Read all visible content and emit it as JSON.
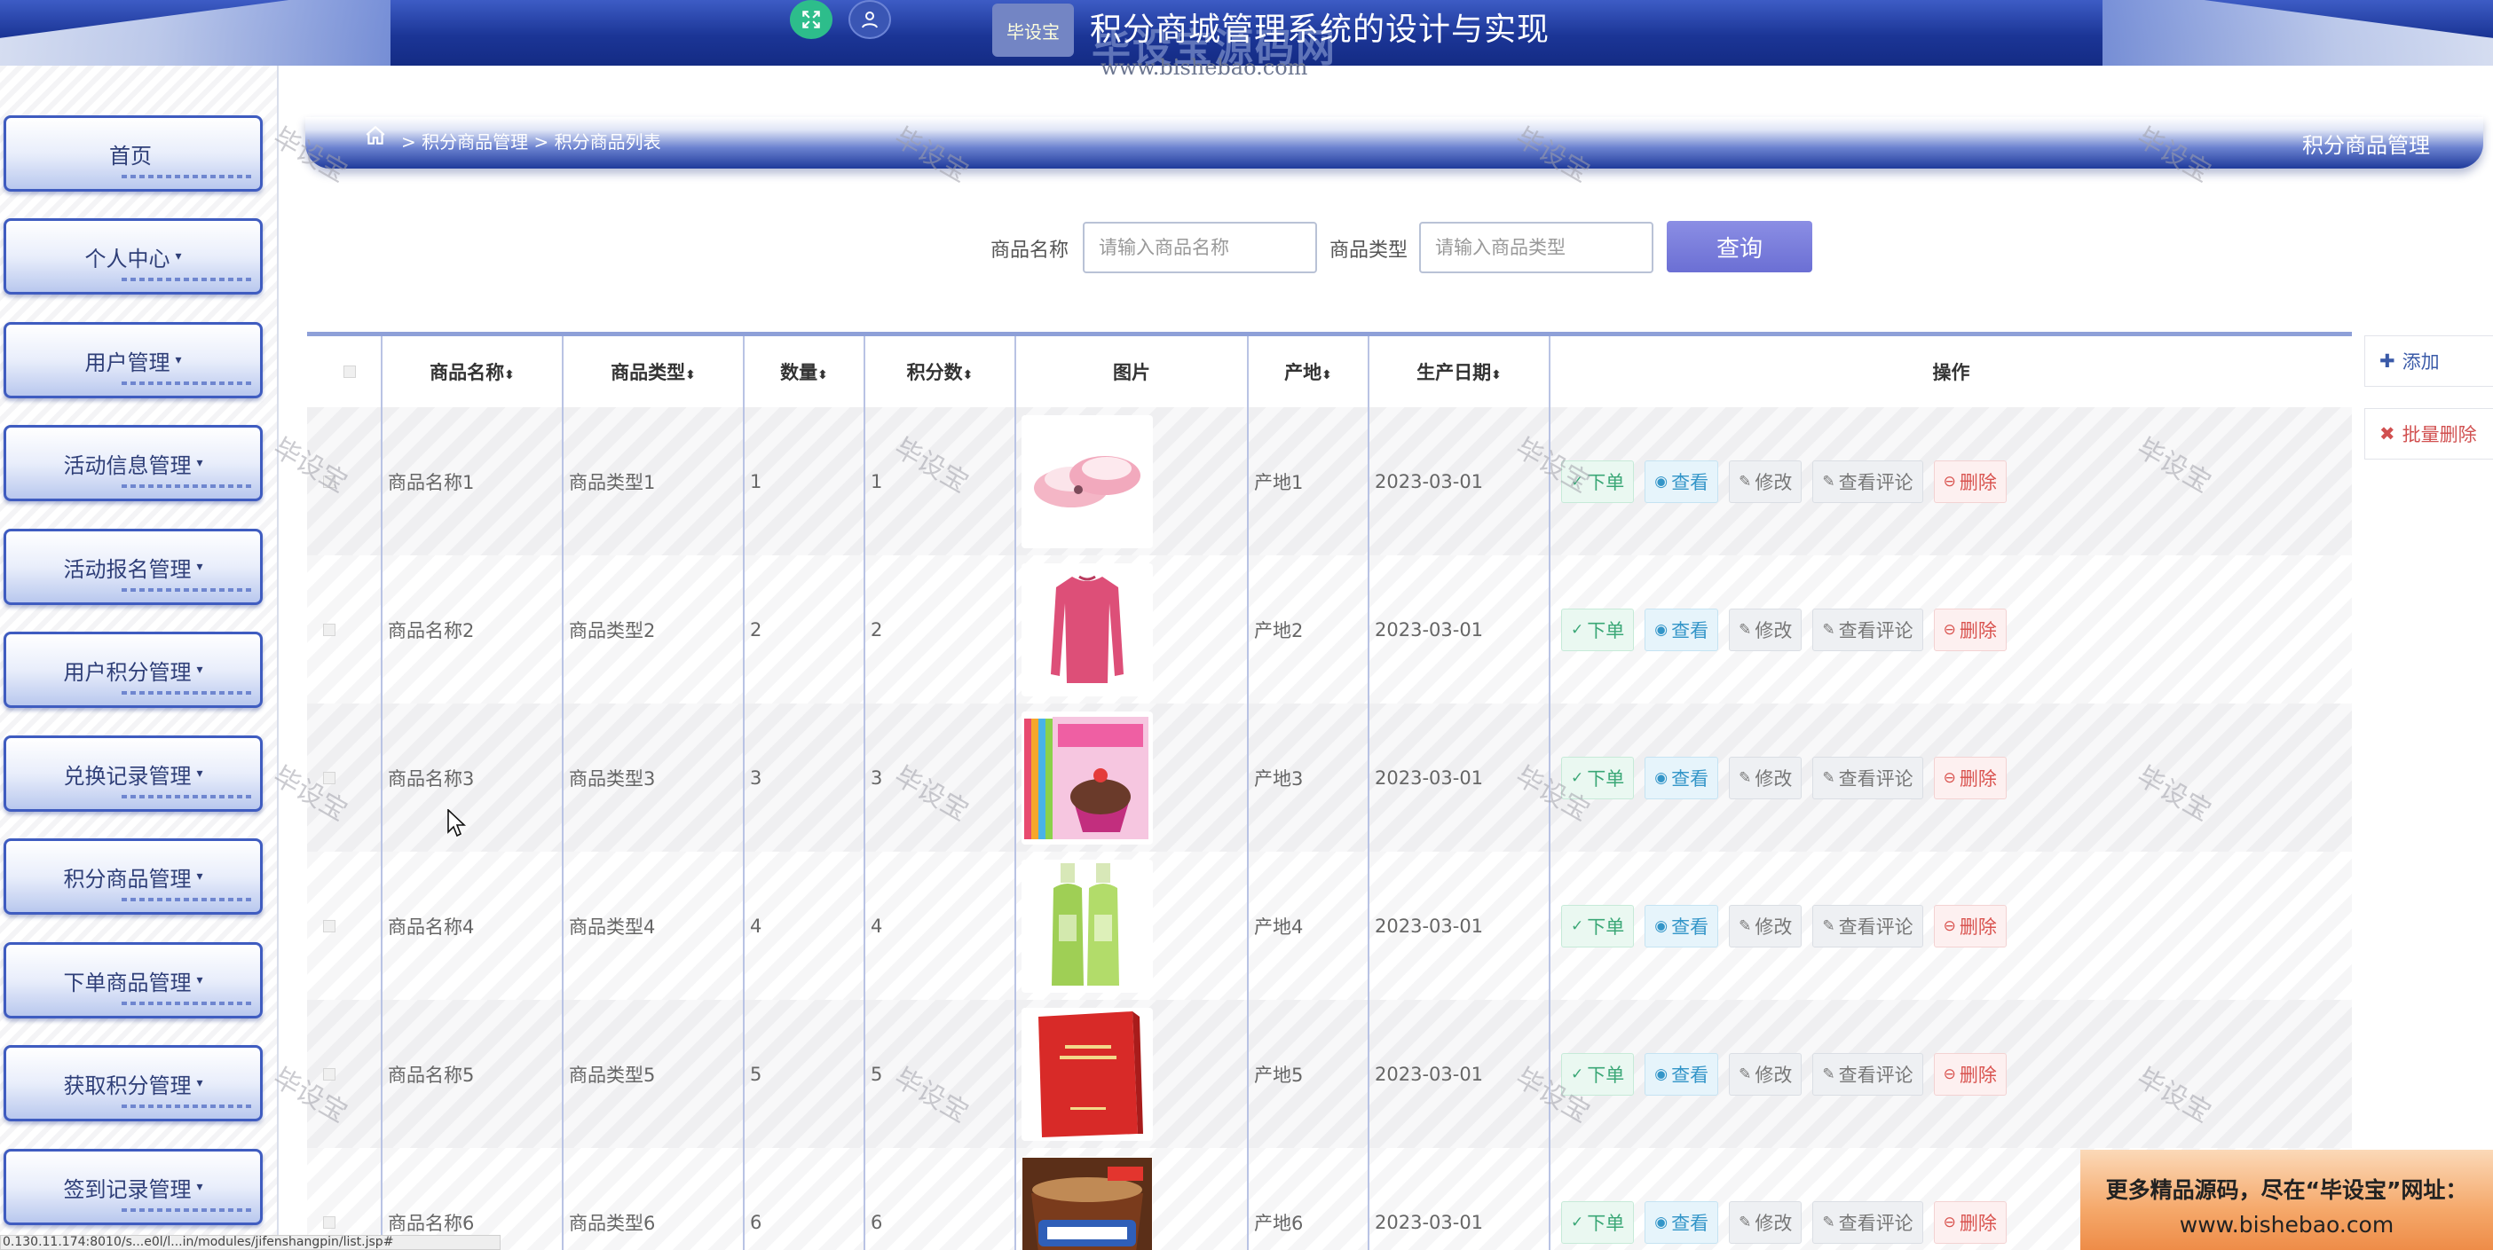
{
  "header": {
    "title": "积分商城管理系统的设计与实现",
    "logo_badge": "毕设宝",
    "logo_watermark": "毕设宝源码网",
    "logo_url": "www.bishebao.com",
    "fullscreen_icon": "fullscreen-icon",
    "user_icon": "user-icon"
  },
  "sidebar": {
    "items": [
      {
        "label": "首页",
        "caret": ""
      },
      {
        "label": "个人中心",
        "caret": "▾"
      },
      {
        "label": "用户管理",
        "caret": "▾"
      },
      {
        "label": "活动信息管理",
        "caret": "▾"
      },
      {
        "label": "活动报名管理",
        "caret": "▾"
      },
      {
        "label": "用户积分管理",
        "caret": "▾"
      },
      {
        "label": "兑换记录管理",
        "caret": "▾"
      },
      {
        "label": "积分商品管理",
        "caret": "▾"
      },
      {
        "label": "下单商品管理",
        "caret": "▾"
      },
      {
        "label": "获取积分管理",
        "caret": "▾"
      },
      {
        "label": "签到记录管理",
        "caret": "▾"
      }
    ]
  },
  "breadcrumb": {
    "home_icon": "home-icon",
    "path": "> 积分商品管理 > 积分商品列表",
    "page_label": "积分商品管理"
  },
  "search": {
    "name_label": "商品名称",
    "name_placeholder": "请输入商品名称",
    "name_value": "",
    "type_label": "商品类型",
    "type_placeholder": "请输入商品类型",
    "type_value": "",
    "query_button": "查询"
  },
  "actions": {
    "add": "添加",
    "batch_delete": "批量删除"
  },
  "table": {
    "columns": [
      "商品名称",
      "商品类型",
      "数量",
      "积分数",
      "图片",
      "产地",
      "生产日期",
      "操作"
    ],
    "sortable": [
      true,
      true,
      true,
      true,
      false,
      true,
      true,
      false
    ],
    "rows": [
      {
        "name": "商品名称1",
        "type": "商品类型1",
        "qty": "1",
        "points": "1",
        "image": "pink-slipper-image",
        "origin": "产地1",
        "date": "2023-03-01"
      },
      {
        "name": "商品名称2",
        "type": "商品类型2",
        "qty": "2",
        "points": "2",
        "image": "pink-sweater-image",
        "origin": "产地2",
        "date": "2023-03-01"
      },
      {
        "name": "商品名称3",
        "type": "商品类型3",
        "qty": "3",
        "points": "3",
        "image": "coloring-book-image",
        "origin": "产地3",
        "date": "2023-03-01"
      },
      {
        "name": "商品名称4",
        "type": "商品类型4",
        "qty": "4",
        "points": "4",
        "image": "green-bottles-image",
        "origin": "产地4",
        "date": "2023-03-01"
      },
      {
        "name": "商品名称5",
        "type": "商品类型5",
        "qty": "5",
        "points": "5",
        "image": "red-book-image",
        "origin": "产地5",
        "date": "2023-03-01"
      },
      {
        "name": "商品名称6",
        "type": "商品类型6",
        "qty": "6",
        "points": "6",
        "image": "snickers-cup-image",
        "origin": "产地6",
        "date": "2023-03-01"
      }
    ],
    "ops": {
      "order": "下单",
      "view": "查看",
      "edit": "修改",
      "review": "查看评论",
      "delete": "删除"
    }
  },
  "watermark": "毕设宝",
  "promo": {
    "line1": "更多精品源码，尽在“毕设宝”网址：",
    "line2": "www.bishebao.com"
  },
  "statusbar": "0.130.11.174:8010/s...e0l/l...in/modules/jifenshangpin/list.jsp#",
  "colors": {
    "header_blue": "#1b3596",
    "query_button": "#7579d9",
    "order_green": "#3aa776",
    "view_blue": "#3395c8",
    "delete_red": "#d9534f"
  }
}
